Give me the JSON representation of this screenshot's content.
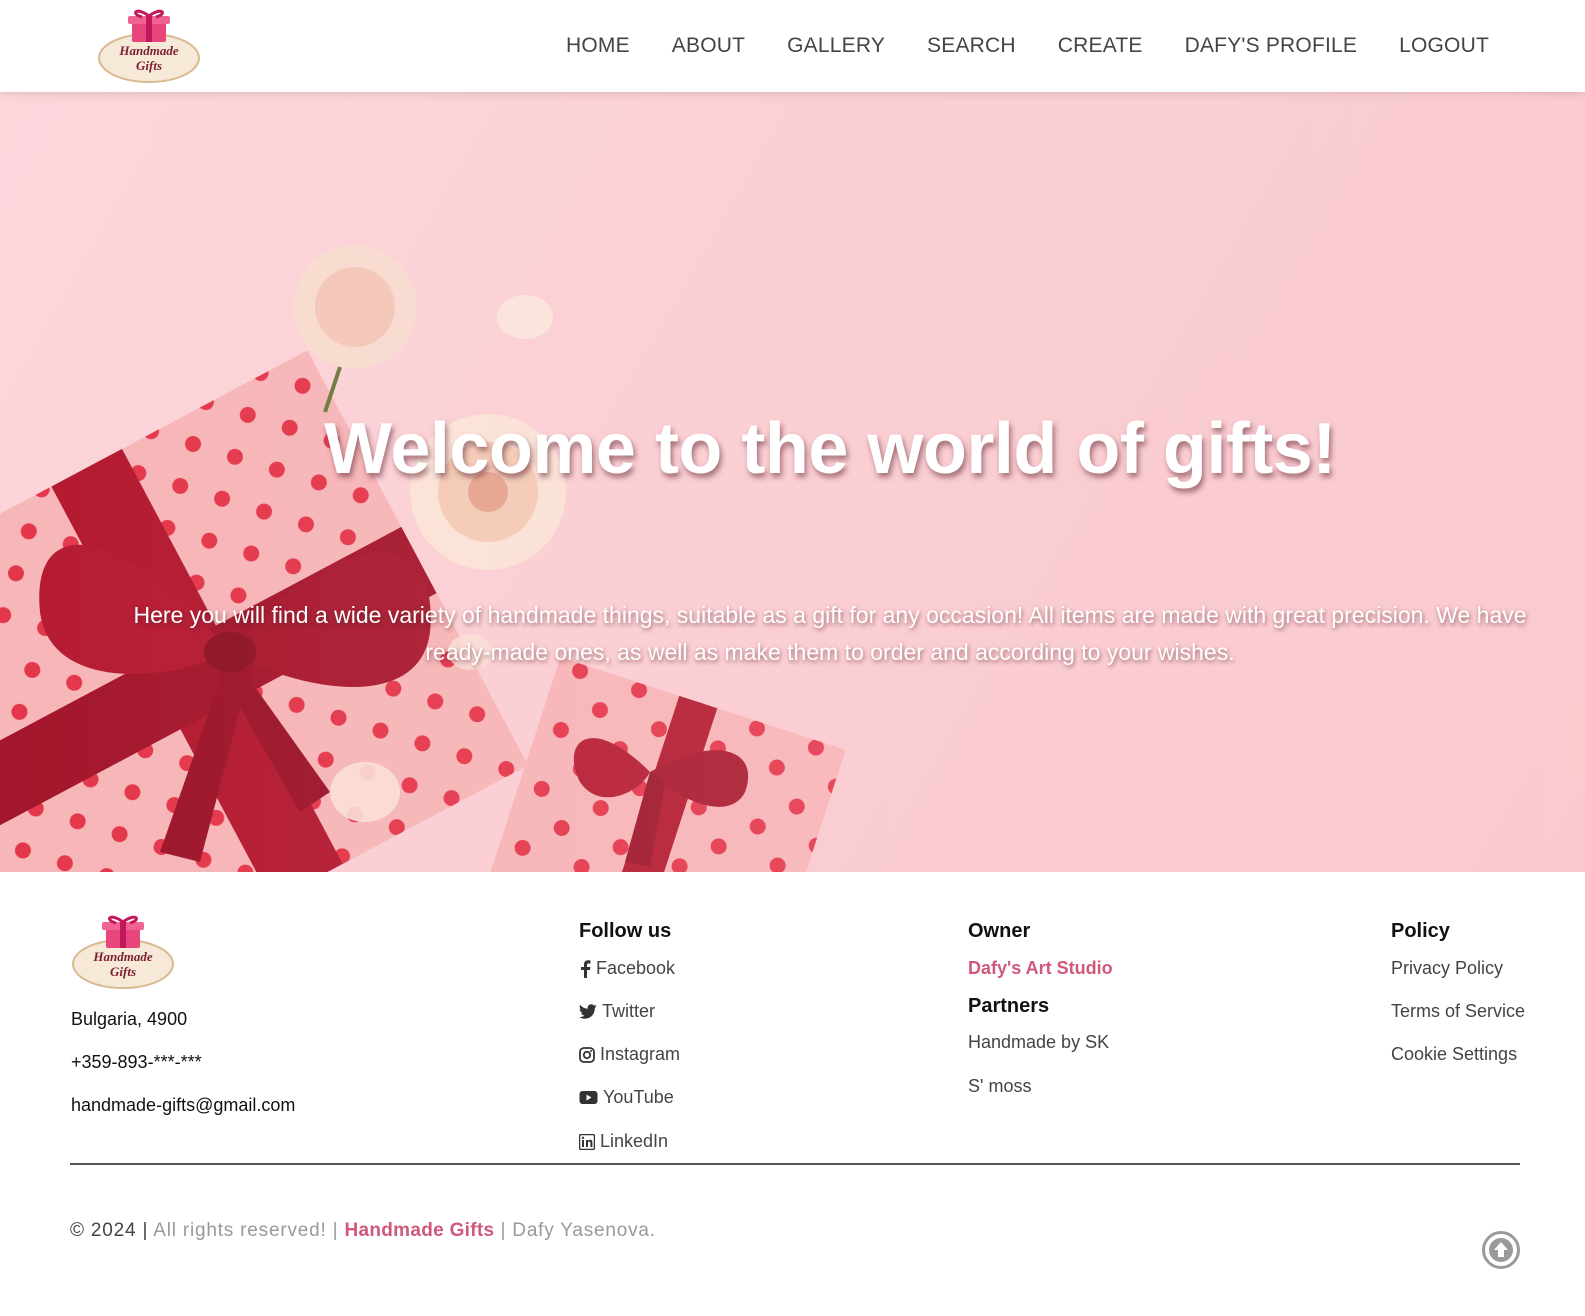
{
  "header": {
    "logo": {
      "line1": "Handmade",
      "line2": "Gifts"
    },
    "nav": [
      {
        "label": "HOME"
      },
      {
        "label": "ABOUT"
      },
      {
        "label": "GALLERY"
      },
      {
        "label": "SEARCH"
      },
      {
        "label": "CREATE"
      },
      {
        "label": "DAFY'S PROFILE"
      },
      {
        "label": "LOGOUT"
      }
    ]
  },
  "hero": {
    "title": "Welcome to the world of gifts!",
    "text": "Here you will find a wide variety of handmade things, suitable as a gift for any occasion! All items are made with great precision. We have ready-made ones, as well as make them to order and according to your wishes."
  },
  "footer": {
    "logo": {
      "line1": "Handmade",
      "line2": "Gifts"
    },
    "address": "Bulgaria, 4900",
    "phone": "+359-893-***-***",
    "email": "handmade-gifts@gmail.com",
    "follow": {
      "heading": "Follow us",
      "links": [
        {
          "label": "Facebook",
          "icon": "facebook-icon"
        },
        {
          "label": "Twitter",
          "icon": "twitter-icon"
        },
        {
          "label": "Instagram",
          "icon": "instagram-icon"
        },
        {
          "label": "YouTube",
          "icon": "youtube-icon"
        },
        {
          "label": "LinkedIn",
          "icon": "linkedin-icon"
        }
      ]
    },
    "owner": {
      "heading": "Owner",
      "name": "Dafy's Art Studio"
    },
    "partners": {
      "heading": "Partners",
      "links": [
        "Handmade by SK",
        "S' moss"
      ]
    },
    "policy": {
      "heading": "Policy",
      "links": [
        "Privacy Policy",
        "Terms of Service",
        "Cookie Settings"
      ]
    },
    "copyright": {
      "year": "© 2024",
      "sep1": "|",
      "rights": "All rights reserved! |",
      "brand": "Handmade Gifts",
      "author": "| Dafy Yasenova."
    }
  },
  "colors": {
    "accent": "#d0587a",
    "hero_bg": "#fbd2d7",
    "ribbon": "#b3192f"
  }
}
